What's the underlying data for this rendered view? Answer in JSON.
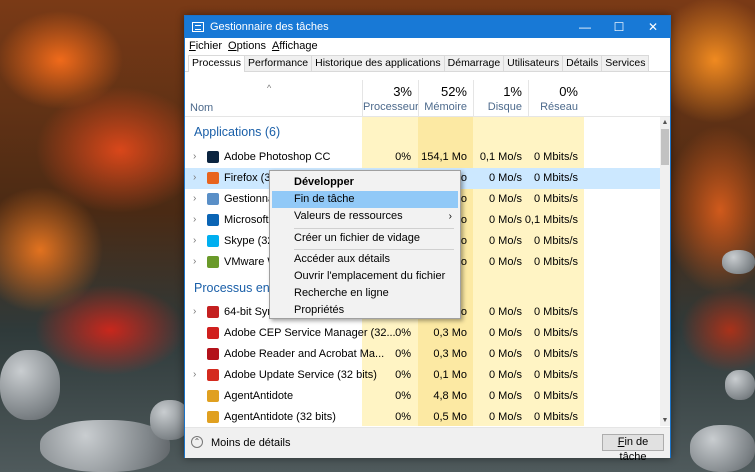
{
  "window": {
    "title": "Gestionnaire des tâches",
    "minimize": "—",
    "maximize": "☐",
    "close": "✕"
  },
  "menu": [
    {
      "pre": "",
      "key": "F",
      "post": "ichier"
    },
    {
      "pre": "",
      "key": "O",
      "post": "ptions"
    },
    {
      "pre": "",
      "key": "A",
      "post": "ffichage"
    }
  ],
  "tabs": [
    "Processus",
    "Performance",
    "Historique des applications",
    "Démarrage",
    "Utilisateurs",
    "Détails",
    "Services"
  ],
  "columns": {
    "name": "Nom",
    "sort": "^",
    "cpu": {
      "pct": "3%",
      "label": "Processeur"
    },
    "mem": {
      "pct": "52%",
      "label": "Mémoire"
    },
    "disk": {
      "pct": "1%",
      "label": "Disque"
    },
    "net": {
      "pct": "0%",
      "label": "Réseau"
    }
  },
  "groups": {
    "apps": "Applications (6)",
    "background": "Processus en a"
  },
  "rows": [
    {
      "chev": "›",
      "icon": "photoshop-icon",
      "color": "#0b2440",
      "name": "Adobe Photoshop CC",
      "cpu": "0%",
      "mem": "154,1 Mo",
      "disk": "0,1 Mo/s",
      "net": "0 Mbits/s"
    },
    {
      "chev": "›",
      "icon": "firefox-icon",
      "color": "#e8641e",
      "name": "Firefox (32",
      "cpu": "",
      "mem": "o",
      "disk": "0 Mo/s",
      "net": "0 Mbits/s"
    },
    {
      "chev": "›",
      "icon": "gestionnaire-icon",
      "color": "#5a8fc7",
      "name": "Gestionnai",
      "cpu": "",
      "mem": "o",
      "disk": "0 Mo/s",
      "net": "0 Mbits/s"
    },
    {
      "chev": "›",
      "icon": "outlook-icon",
      "color": "#0a64b4",
      "name": "Microsoft C",
      "cpu": "",
      "mem": "o",
      "disk": "0 Mo/s",
      "net": "0,1 Mbits/s"
    },
    {
      "chev": "›",
      "icon": "skype-icon",
      "color": "#00aff0",
      "name": "Skype (32 b",
      "cpu": "",
      "mem": "o",
      "disk": "0 Mo/s",
      "net": "0 Mbits/s"
    },
    {
      "chev": "›",
      "icon": "vmware-icon",
      "color": "#6a9a2a",
      "name": "VMware W",
      "cpu": "",
      "mem": "o",
      "disk": "0 Mo/s",
      "net": "0 Mbits/s"
    },
    {
      "chev": "›",
      "icon": "synaptics-icon",
      "color": "#c42020",
      "name": "64-bit Syna",
      "cpu": "",
      "mem": "o",
      "disk": "0 Mo/s",
      "net": "0 Mbits/s"
    },
    {
      "chev": "",
      "icon": "adobe-cep-icon",
      "color": "#d0201e",
      "name": "Adobe CEP Service Manager (32...",
      "cpu": "0%",
      "mem": "0,3 Mo",
      "disk": "0 Mo/s",
      "net": "0 Mbits/s"
    },
    {
      "chev": "",
      "icon": "acrobat-icon",
      "color": "#b3121a",
      "name": "Adobe Reader and Acrobat Ma...",
      "cpu": "0%",
      "mem": "0,3 Mo",
      "disk": "0 Mo/s",
      "net": "0 Mbits/s"
    },
    {
      "chev": "›",
      "icon": "adobe-update-icon",
      "color": "#d42a1e",
      "name": "Adobe Update Service (32 bits)",
      "cpu": "0%",
      "mem": "0,1 Mo",
      "disk": "0 Mo/s",
      "net": "0 Mbits/s"
    },
    {
      "chev": "",
      "icon": "agent-antidote-icon",
      "color": "#e0a020",
      "name": "AgentAntidote",
      "cpu": "0%",
      "mem": "4,8 Mo",
      "disk": "0 Mo/s",
      "net": "0 Mbits/s"
    },
    {
      "chev": "",
      "icon": "agent-antidote-icon",
      "color": "#e0a020",
      "name": "AgentAntidote (32 bits)",
      "cpu": "0%",
      "mem": "0,5 Mo",
      "disk": "0 Mo/s",
      "net": "0 Mbits/s"
    }
  ],
  "context_menu": {
    "items": [
      {
        "label": "Développer",
        "bold": true
      },
      {
        "label": "Fin de tâche",
        "selected": true
      },
      {
        "label": "Valeurs de ressources",
        "submenu": "›"
      },
      {
        "label": "Créer un fichier de vidage"
      },
      {
        "label": "Accéder aux détails"
      },
      {
        "label": "Ouvrir l'emplacement du fichier"
      },
      {
        "label": "Recherche en ligne"
      },
      {
        "label": "Propriétés"
      }
    ]
  },
  "footer": {
    "less_icon": "⌃",
    "less_label": "Moins de détails",
    "end_task_key": "F",
    "end_task_rest": "in de tâche"
  }
}
